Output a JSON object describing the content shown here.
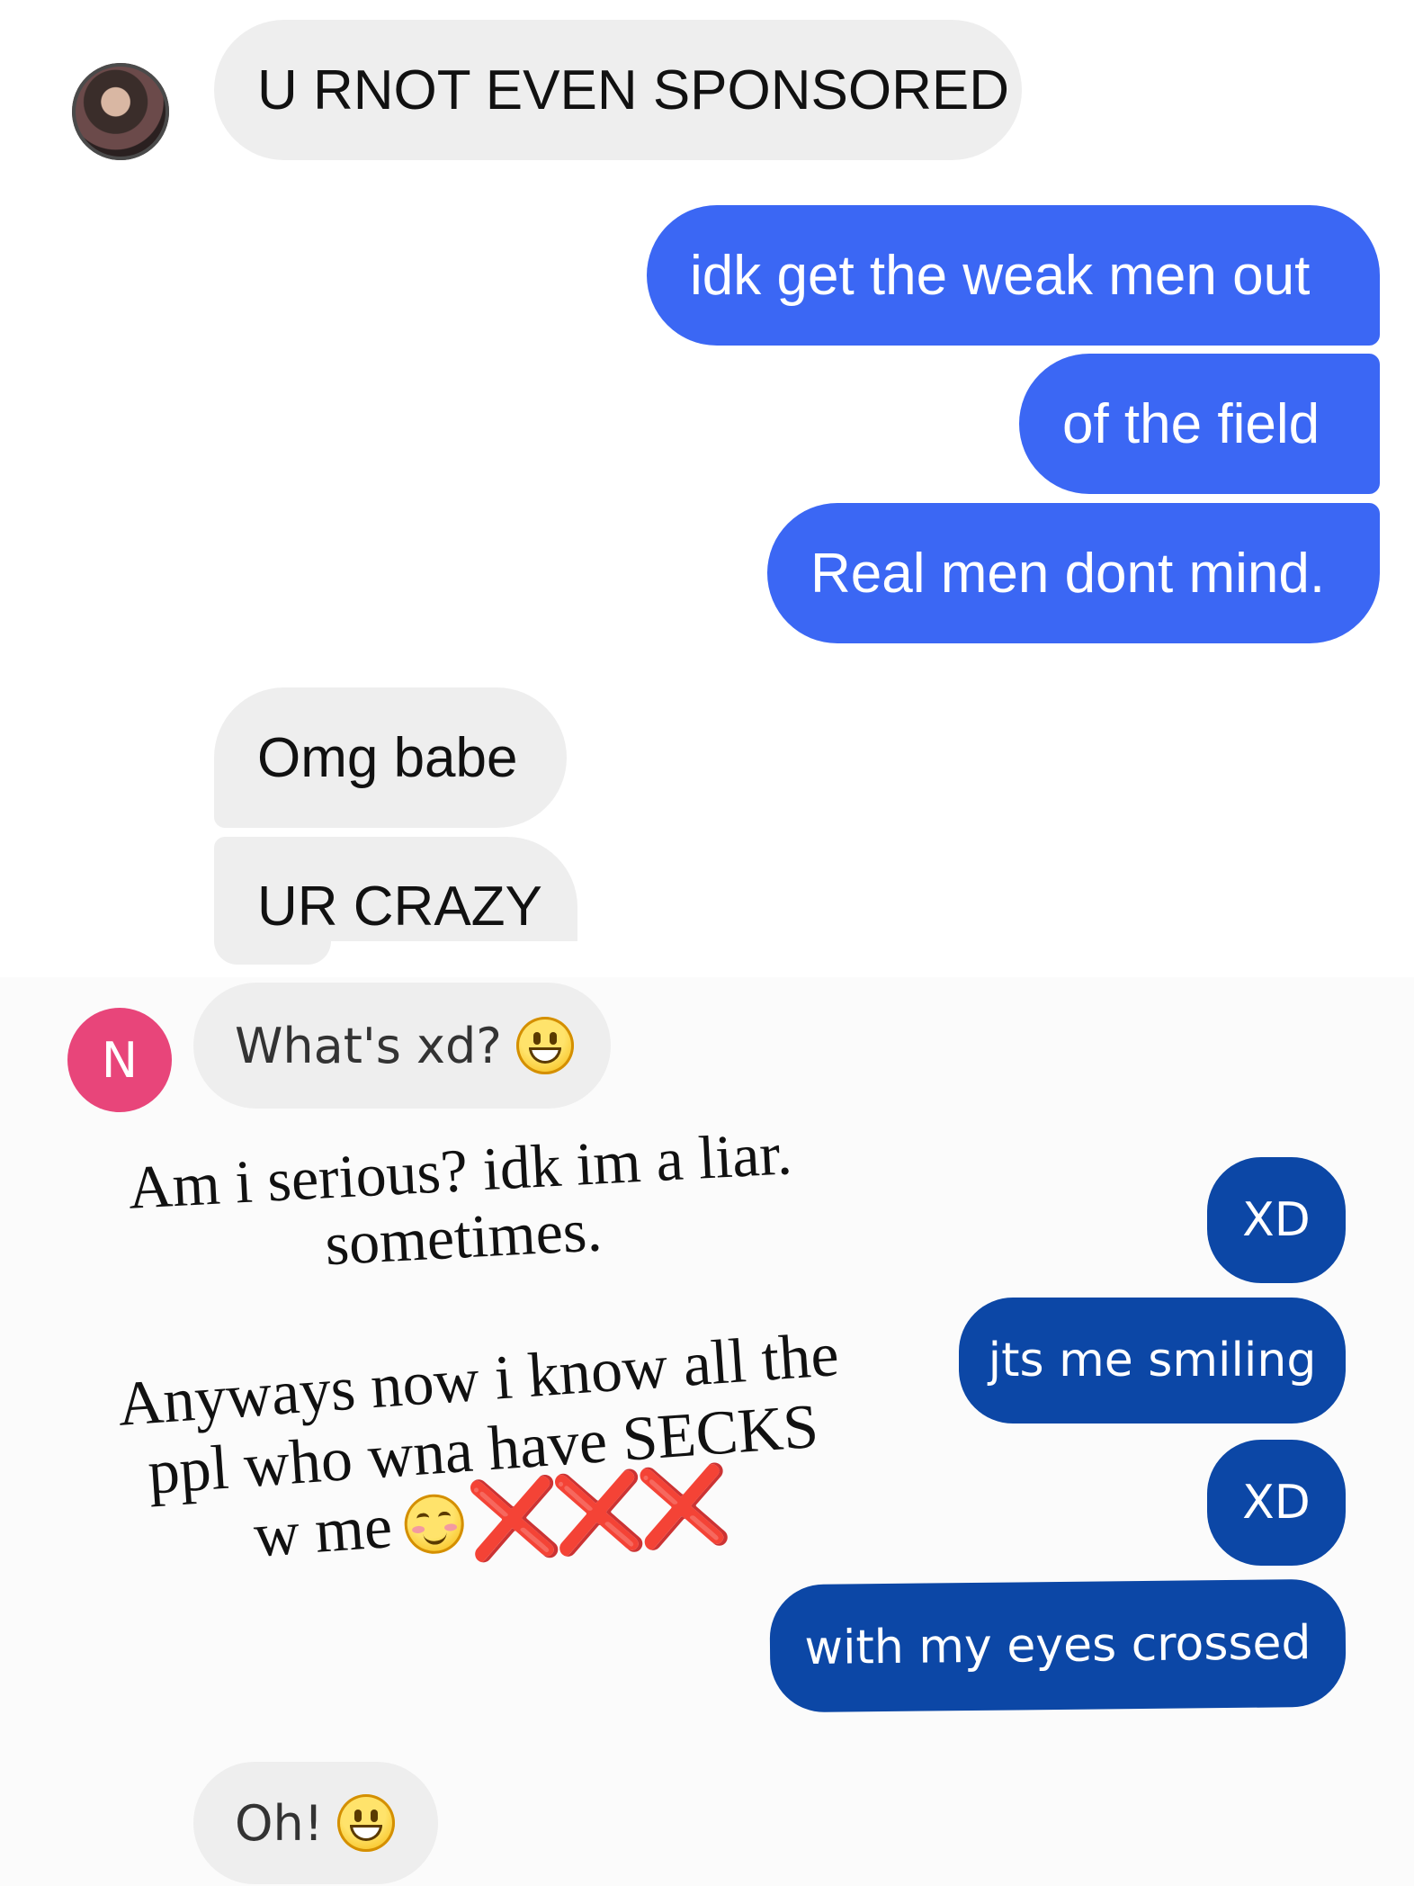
{
  "messages": {
    "m1": "U RNOT EVEN SPONSORED",
    "m2": "idk get the weak men out",
    "m3": "of the field",
    "m4": "Real men dont mind.",
    "m5": "Omg babe",
    "m6": "UR CRAZY",
    "m7": "What's xd?",
    "m8": "XD",
    "m9": "jts me smiling",
    "m10": "XD",
    "m11": "with my eyes crossed",
    "m12": "Oh!"
  },
  "avatar": {
    "initial": "N",
    "color": "#e8457a"
  },
  "overlay": {
    "line1": "Am i serious? idk im a liar.",
    "line2": "sometimes.",
    "line3": "Anyways now i know all the",
    "line4": "ppl who wna have SECKS",
    "line5": "w me",
    "marks": "❌❌❌"
  },
  "colors": {
    "incoming": "#eeeeee",
    "outgoing_bright": "#3b67f4",
    "outgoing_dark": "#0c47a6",
    "avatar_n": "#e8457a"
  },
  "icons": [
    "profile-photo",
    "grinning-face-emoji",
    "smiling-blush-emoji",
    "cross-mark-emoji"
  ]
}
